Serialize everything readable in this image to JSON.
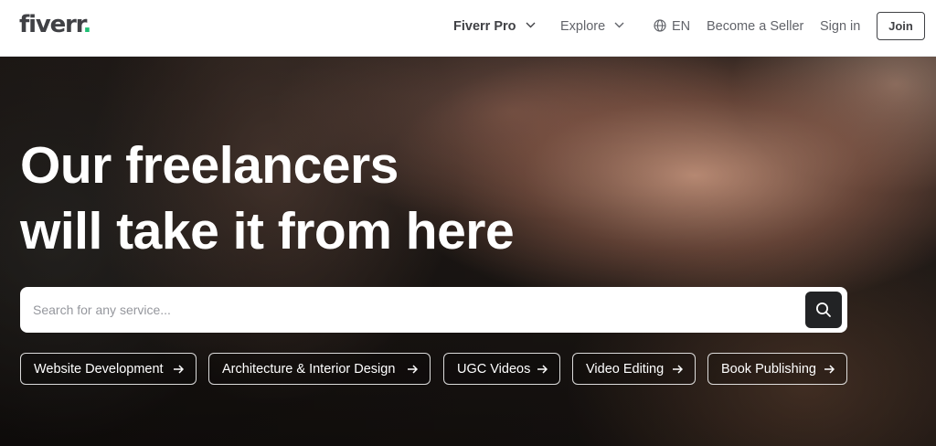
{
  "brand": {
    "name": "fiverr",
    "dot": ".",
    "dot_color": "#1dbf73"
  },
  "nav": {
    "pro_label": "Fiverr Pro",
    "explore_label": "Explore",
    "language_label": "EN",
    "seller_label": "Become a Seller",
    "signin_label": "Sign in",
    "join_label": "Join"
  },
  "hero": {
    "headline_line1": "Our freelancers",
    "headline_line2": "will take it from here"
  },
  "search": {
    "placeholder": "Search for any service...",
    "value": ""
  },
  "chips": [
    {
      "label": "Website Development"
    },
    {
      "label": "Architecture & Interior Design"
    },
    {
      "label": "UGC Videos"
    },
    {
      "label": "Video Editing"
    },
    {
      "label": "Book Publishing"
    }
  ]
}
